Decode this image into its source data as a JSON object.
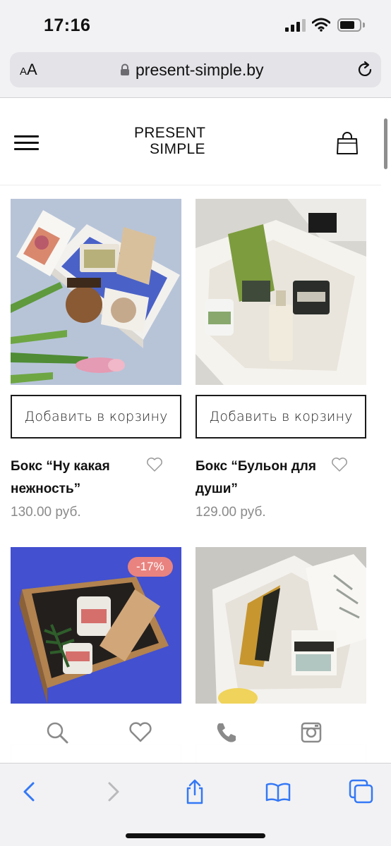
{
  "status_bar": {
    "time": "17:16"
  },
  "browser": {
    "text_size_button": "AA",
    "url": "present-simple.by"
  },
  "header": {
    "logo_line1": "PRESENT",
    "logo_line2": "SIMPLE"
  },
  "products": [
    {
      "name": "Бокс “Ну какая нежность”",
      "price": "130.00 руб.",
      "add_label": "Добавить в корзину"
    },
    {
      "name": "Бокс “Бульон для души”",
      "price": "129.00 руб.",
      "add_label": "Добавить в корзину"
    },
    {
      "badge": "-17%"
    },
    {}
  ],
  "colors": {
    "badge": "#e9837f",
    "link_blue": "#3478f6",
    "price_grey": "#8a8a8a"
  },
  "icons": {
    "site_bottom_bar": [
      "search-icon",
      "heart-icon",
      "phone-icon",
      "instagram-icon"
    ],
    "safari_toolbar": [
      "back-icon",
      "forward-icon",
      "share-icon",
      "bookmarks-icon",
      "tabs-icon"
    ]
  }
}
